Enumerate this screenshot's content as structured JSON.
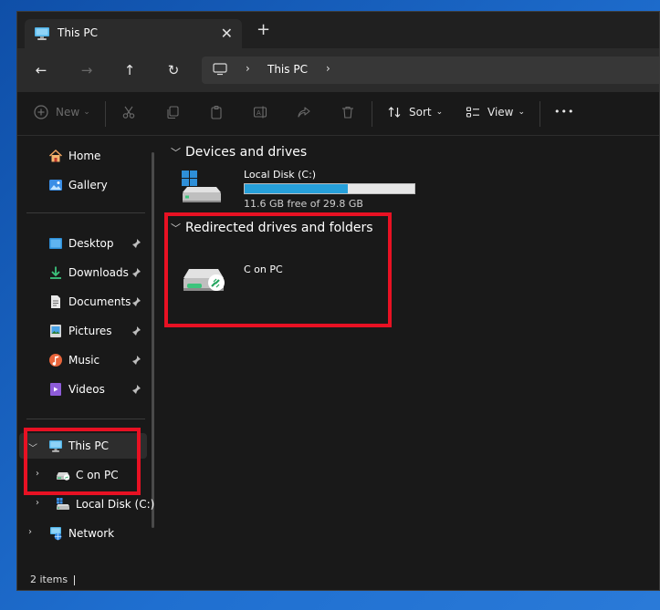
{
  "window": {
    "tab_title": "This PC",
    "close_glyph": "✕",
    "new_tab_glyph": "+"
  },
  "nav": {
    "back_glyph": "←",
    "forward_glyph": "→",
    "up_glyph": "↑",
    "refresh_glyph": "↻",
    "address_path": "This PC",
    "chevron": "›"
  },
  "commands": {
    "new_label": "New",
    "sort_label": "Sort",
    "view_label": "View",
    "more_glyph": "•••"
  },
  "sidebar": {
    "items": [
      {
        "label": "Home",
        "icon": "home-icon"
      },
      {
        "label": "Gallery",
        "icon": "gallery-icon"
      },
      {
        "label": "Desktop",
        "icon": "desktop-icon",
        "pinned": true
      },
      {
        "label": "Downloads",
        "icon": "downloads-icon",
        "pinned": true
      },
      {
        "label": "Documents",
        "icon": "documents-icon",
        "pinned": true
      },
      {
        "label": "Pictures",
        "icon": "pictures-icon",
        "pinned": true
      },
      {
        "label": "Music",
        "icon": "music-icon",
        "pinned": true
      },
      {
        "label": "Videos",
        "icon": "videos-icon",
        "pinned": true
      },
      {
        "label": "This PC",
        "icon": "pc-icon",
        "selected": true
      },
      {
        "label": "C on PC",
        "icon": "redirected-drive-icon"
      },
      {
        "label": "Local Disk (C:)",
        "icon": "local-disk-icon"
      },
      {
        "label": "Network",
        "icon": "network-icon"
      }
    ]
  },
  "content": {
    "devices_section": "Devices and drives",
    "redirected_section": "Redirected drives and folders",
    "local_disk": {
      "name": "Local Disk (C:)",
      "free_text": "11.6 GB free of 29.8 GB",
      "used_fraction": 0.61
    },
    "redirected_drive": {
      "name": "C on PC"
    }
  },
  "status": {
    "items_count": "2 items"
  },
  "colors": {
    "accent": "#26a0da",
    "highlight": "#e81123"
  }
}
